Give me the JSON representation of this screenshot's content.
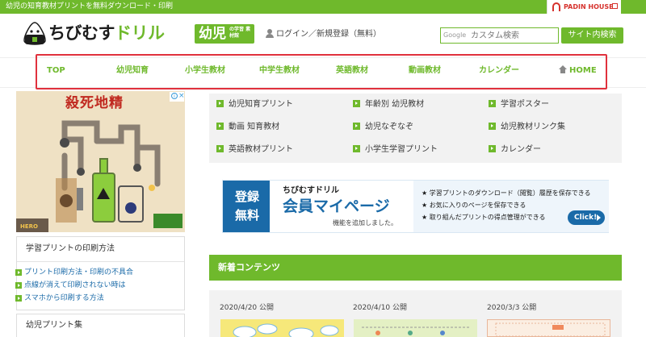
{
  "topbar": {
    "tagline": "幼児の知育教材プリントを無料ダウンロード・印刷"
  },
  "padin": {
    "label": "PADIN HOUSE"
  },
  "header": {
    "logo_main": "ちびむす",
    "logo_drill": "ドリル",
    "logo_badge_main": "幼児",
    "logo_badge_sub": "の学習 素材館",
    "login_text": "ログイン／新規登録（無料）",
    "search_brand": "Google",
    "search_placeholder": "カスタム検索",
    "search_button": "サイト内検索"
  },
  "nav": {
    "items": [
      {
        "label": "TOP"
      },
      {
        "label": "幼児知育"
      },
      {
        "label": "小学生教材"
      },
      {
        "label": "中学生教材"
      },
      {
        "label": "英語教材"
      },
      {
        "label": "動画教材"
      },
      {
        "label": "カレンダー"
      },
      {
        "label": "HOME"
      }
    ]
  },
  "ad": {
    "title": "殺死地精"
  },
  "links": {
    "items": [
      {
        "label": "幼児知育プリント"
      },
      {
        "label": "年齢別 幼児教材"
      },
      {
        "label": "学習ポスター"
      },
      {
        "label": "動画 知育教材"
      },
      {
        "label": "幼児なぞなぞ"
      },
      {
        "label": "幼児教材リンク集"
      },
      {
        "label": "英語教材プリント"
      },
      {
        "label": "小学生学習プリント"
      },
      {
        "label": "カレンダー"
      }
    ]
  },
  "banner": {
    "register": "登録 無料",
    "logo": "ちびむすドリル",
    "title": "会員マイページ",
    "subtitle": "機能を追加しました。",
    "points": [
      "★ 学習プリントのダウンロード（閲覧）履歴を保存できる",
      "★ お気に入りのページを保存できる",
      "★ 取り組んだプリントの得点管理ができる"
    ],
    "click": "Click!"
  },
  "new_contents": {
    "title": "新着コンテンツ",
    "posts": [
      {
        "date": "2020/4/20 公開"
      },
      {
        "date": "2020/4/10 公開"
      },
      {
        "date": "2020/3/3 公開"
      }
    ]
  },
  "sidebar": {
    "print_title": "学習プリントの印刷方法",
    "print_links": [
      "プリント印刷方法・印刷の不具合",
      "点線が消えて印刷されない時は",
      "スマホから印刷する方法"
    ],
    "infant_title": "幼児プリント集"
  },
  "colors": {
    "brand_green": "#6fb92c",
    "nav_highlight": "#e0313d",
    "banner_blue": "#1a6aa8"
  }
}
